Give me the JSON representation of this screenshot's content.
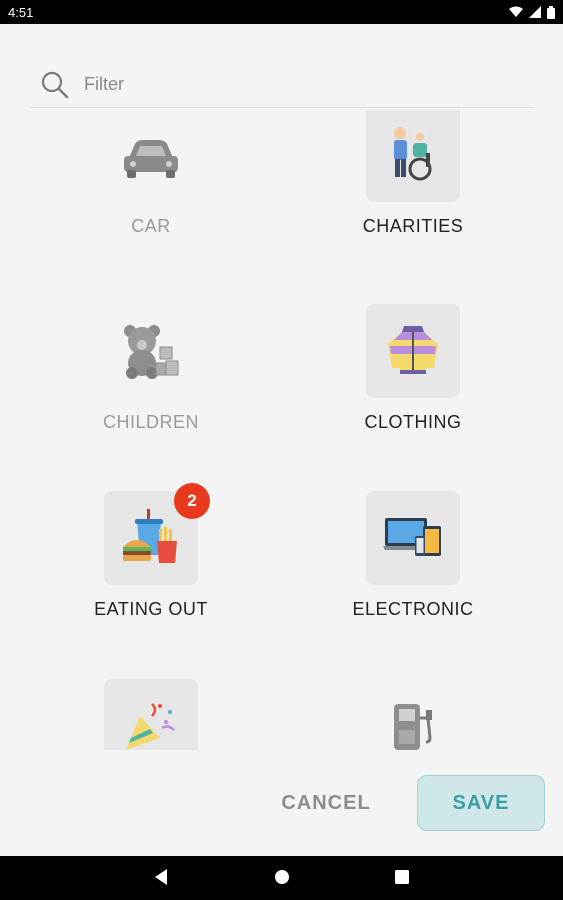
{
  "status_bar": {
    "time": "4:51",
    "icons": [
      "wifi-icon",
      "signal-icon",
      "battery-icon"
    ]
  },
  "search": {
    "placeholder": "Filter",
    "icon": "search-icon"
  },
  "categories": [
    {
      "label": "CAR",
      "icon": "car-icon",
      "selected": false,
      "badge": ""
    },
    {
      "label": "CHARITIES",
      "icon": "charities-icon",
      "selected": true,
      "badge": ""
    },
    {
      "label": "CHILDREN",
      "icon": "teddy-bear-icon",
      "selected": false,
      "badge": ""
    },
    {
      "label": "CLOTHING",
      "icon": "jacket-icon",
      "selected": true,
      "badge": ""
    },
    {
      "label": "EATING OUT",
      "icon": "fast-food-icon",
      "selected": true,
      "badge": "2"
    },
    {
      "label": "ELECTRONIC",
      "icon": "devices-icon",
      "selected": true,
      "badge": ""
    },
    {
      "label": "",
      "icon": "party-icon",
      "selected": true,
      "badge": ""
    },
    {
      "label": "",
      "icon": "fuel-pump-icon",
      "selected": false,
      "badge": ""
    }
  ],
  "actions": {
    "cancel": "CANCEL",
    "save": "SAVE"
  },
  "colors": {
    "accent": "#3b9ea4",
    "badge": "#e8391f",
    "tile_bg": "#e6e6e6",
    "dim_text": "#9a9a9a"
  }
}
